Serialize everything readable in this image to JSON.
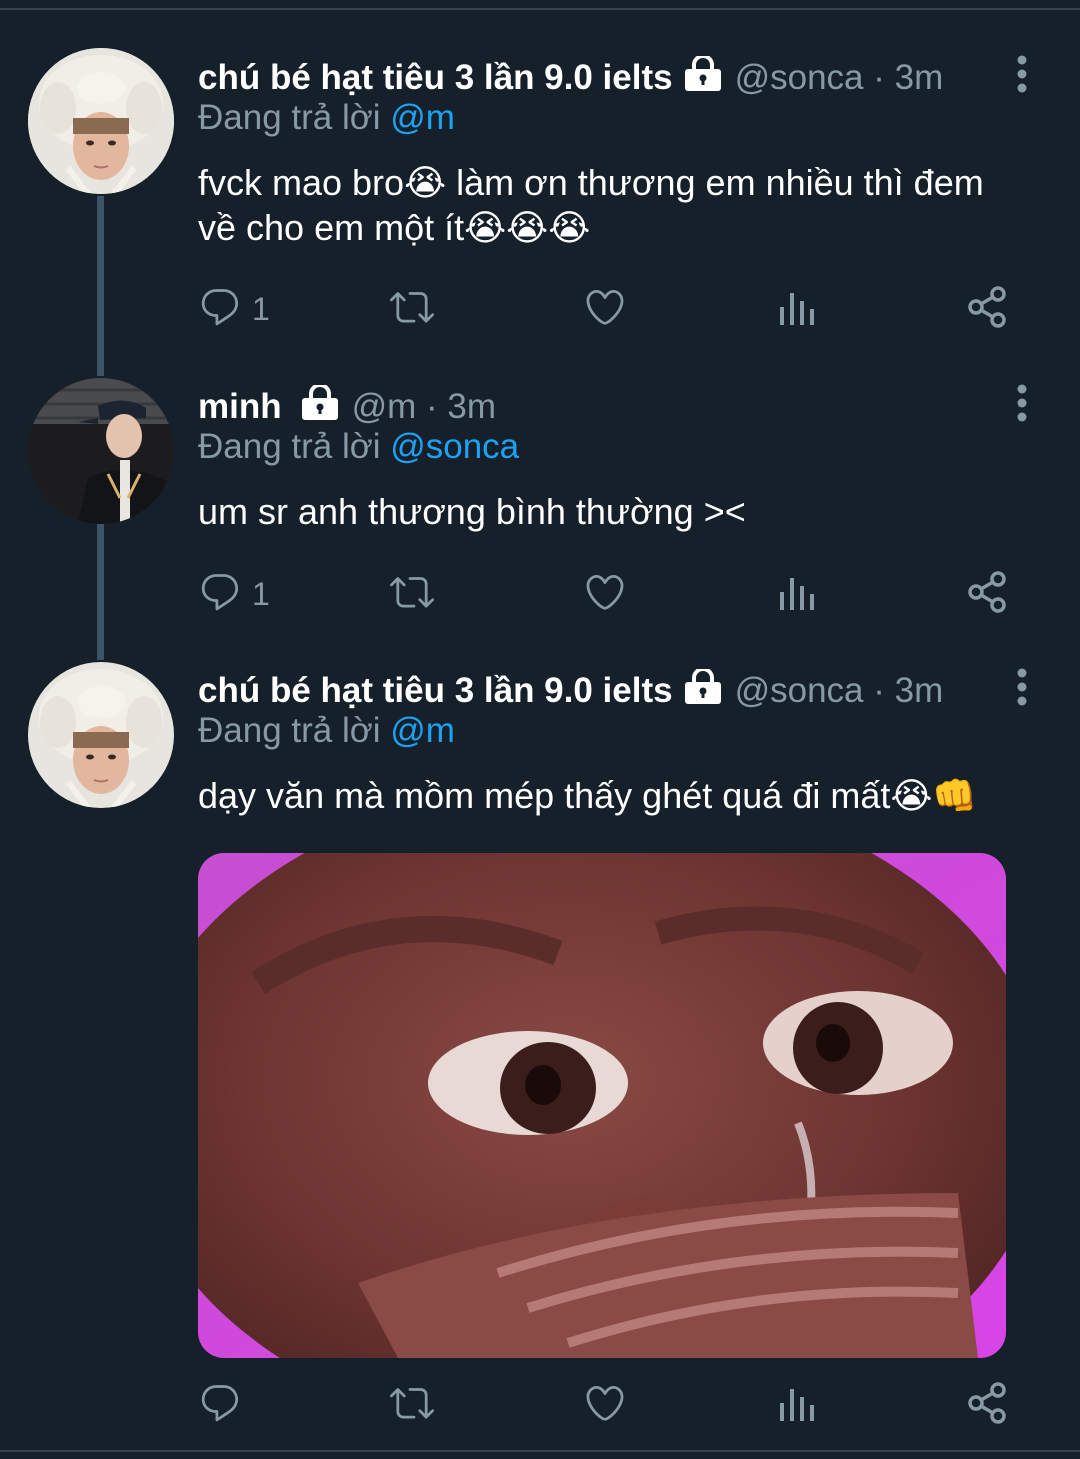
{
  "tweets": [
    {
      "display_name": "chú bé hạt tiêu 3 lần 9.0 ielts",
      "handle_time": "@sonca · 3m",
      "replying_prefix": "Đang trả lời",
      "replying_to": "@m",
      "text_line1": "fvck mao bro😭 làm ơn thương em nhiều thì đem",
      "text_line2": "về cho em một ít😭😭😭",
      "reply_count": "1"
    },
    {
      "display_name": "minh",
      "handle_time": "@m · 3m",
      "replying_prefix": "Đang trả lời",
      "replying_to": "@sonca",
      "text_line1": "um sr anh thương bình thường ><",
      "reply_count": "1"
    },
    {
      "display_name": "chú bé hạt tiêu 3 lần 9.0 ielts",
      "handle_time": "@sonca · 3m",
      "replying_prefix": "Đang trả lời",
      "replying_to": "@m",
      "text_line1": "dạy văn mà mồm mép thấy ghét quá đi mất😭👊",
      "reply_count": ""
    }
  ],
  "colors": {
    "background": "#15202b",
    "secondary_text": "#8899a6",
    "accent": "#1da1f2",
    "thread_line": "#3d5466"
  },
  "icons": [
    "lock-icon",
    "more-icon",
    "reply-icon",
    "retweet-icon",
    "like-icon",
    "analytics-icon",
    "share-icon"
  ]
}
